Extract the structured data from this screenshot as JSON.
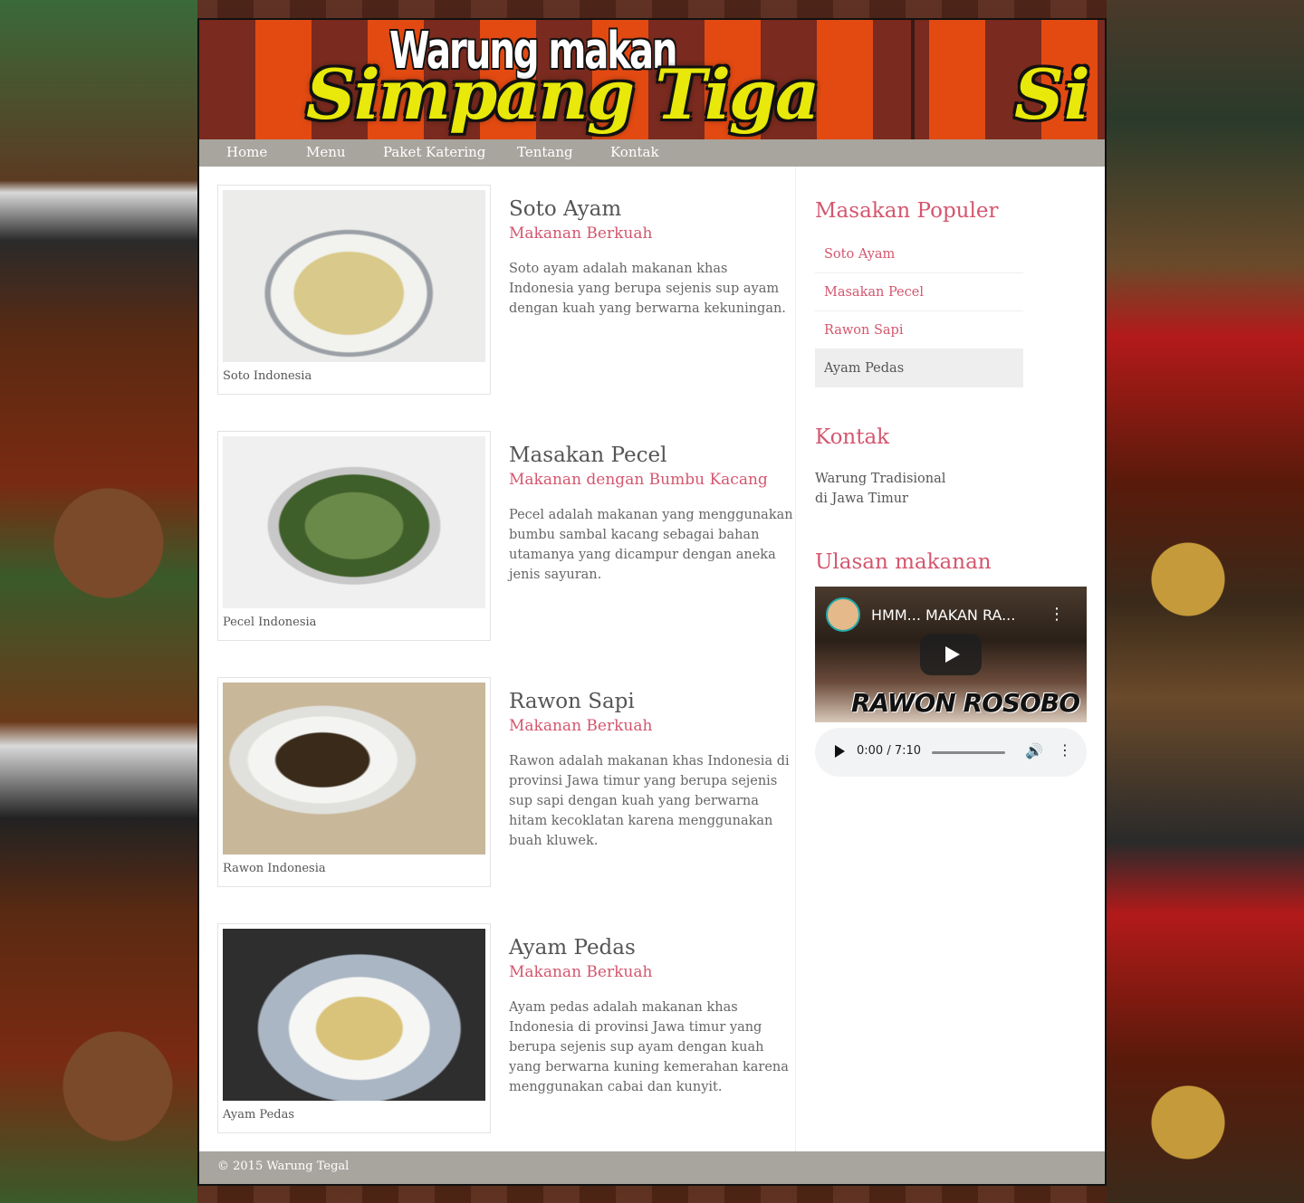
{
  "banner": {
    "line1": "Warung makan",
    "line2": "Simpang Tiga",
    "line2_repeat": "Si"
  },
  "nav": [
    "Home",
    "Menu",
    "Paket Katering",
    "Tentang",
    "Kontak"
  ],
  "posts": [
    {
      "caption": "Soto Indonesia",
      "title": "Soto Ayam",
      "subtitle": "Makanan Berkuah",
      "text": "Soto ayam adalah makanan khas Indonesia yang berupa sejenis sup ayam dengan kuah yang berwarna kekuningan."
    },
    {
      "caption": "Pecel Indonesia",
      "title": "Masakan Pecel",
      "subtitle": "Makanan dengan Bumbu Kacang",
      "text": "Pecel adalah makanan yang menggunakan bumbu sambal kacang sebagai bahan utamanya yang dicampur dengan aneka jenis sayuran."
    },
    {
      "caption": "Rawon Indonesia",
      "title": "Rawon Sapi",
      "subtitle": "Makanan Berkuah",
      "text": "Rawon adalah makanan khas Indonesia di provinsi Jawa timur yang berupa sejenis sup sapi dengan kuah yang berwarna hitam kecoklatan karena menggunakan buah kluwek."
    },
    {
      "caption": "Ayam Pedas",
      "title": "Ayam Pedas",
      "subtitle": "Makanan Berkuah",
      "text": "Ayam pedas adalah makanan khas Indonesia di provinsi Jawa timur yang berupa sejenis sup ayam dengan kuah yang berwarna kuning kemerahan karena menggunakan cabai dan kunyit."
    }
  ],
  "sidebar": {
    "popular_title": "Masakan Populer",
    "popular": [
      "Soto Ayam",
      "Masakan Pecel",
      "Rawon Sapi",
      "Ayam Pedas"
    ],
    "contact_title": "Kontak",
    "contact_line1": "Warung Tradisional",
    "contact_line2": "di Jawa Timur",
    "review_title": "Ulasan makanan",
    "video_title": "HMM... MAKAN RA...",
    "video_caption": "RAWON ROSOBO",
    "audio_time": "0:00 / 7:10"
  },
  "footer": "© 2015 Warung Tegal",
  "colors": {
    "accent": "#d4566e",
    "nav_bg": "#a8a59e"
  },
  "icons": {
    "play": "play-icon",
    "volume": "volume-icon",
    "more": "more-vert-icon"
  }
}
